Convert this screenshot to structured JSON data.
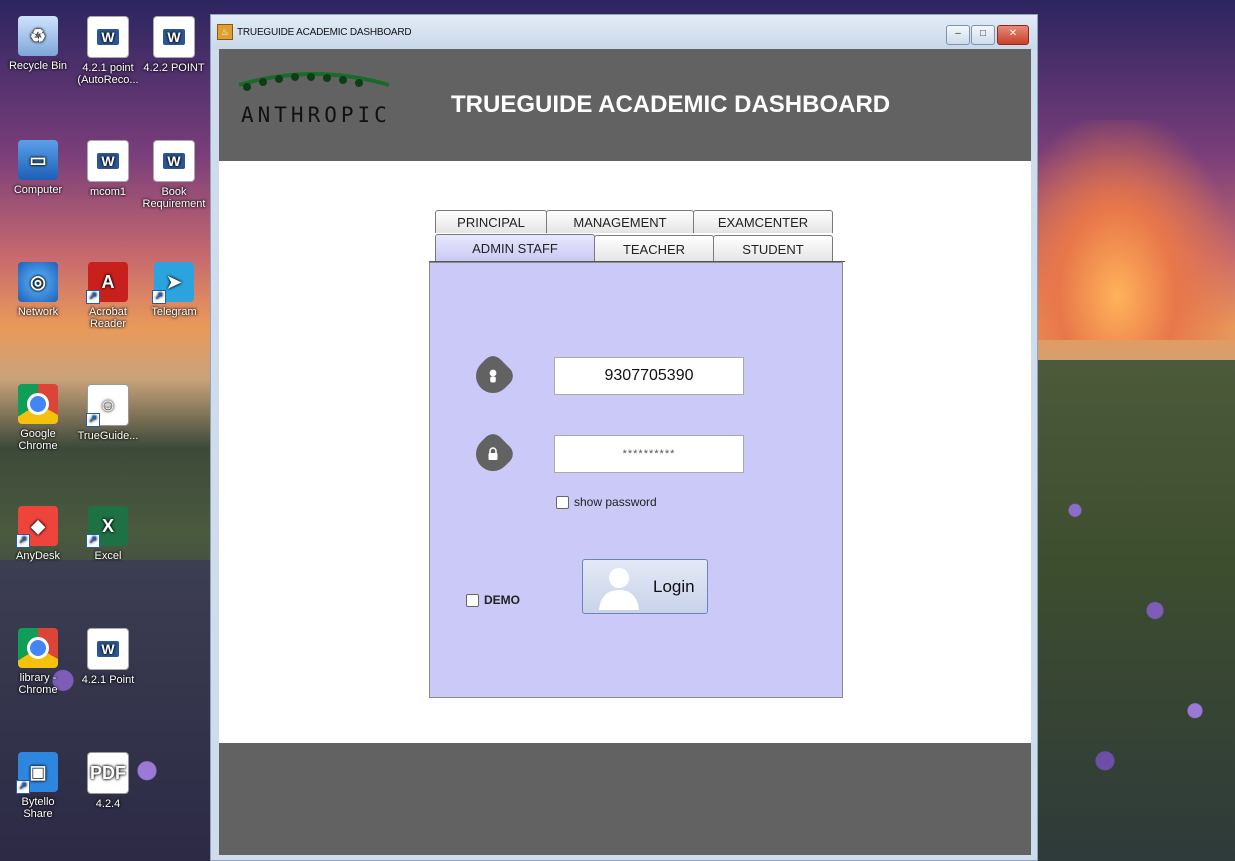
{
  "desktop": {
    "icons": [
      {
        "label": "Recycle Bin"
      },
      {
        "label": "4.2.1 point (AutoReco..."
      },
      {
        "label": "4.2.2 POINT"
      },
      {
        "label": "Computer"
      },
      {
        "label": "mcom1"
      },
      {
        "label": "Book Requirement"
      },
      {
        "label": "Network"
      },
      {
        "label": "Acrobat Reader"
      },
      {
        "label": "Telegram"
      },
      {
        "label": "Google Chrome"
      },
      {
        "label": "TrueGuide..."
      },
      {
        "label": "AnyDesk"
      },
      {
        "label": "Excel"
      },
      {
        "label": "library - Chrome"
      },
      {
        "label": "4.2.1 Point"
      },
      {
        "label": "Bytello Share"
      },
      {
        "label": "4.2.4"
      }
    ]
  },
  "window": {
    "title": "TRUEGUIDE ACADEMIC DASHBOARD",
    "controls": {
      "minimize": "–",
      "maximize": "□",
      "close": "✕"
    }
  },
  "header": {
    "logo_text": "ANTHROPIC",
    "title": "TRUEGUIDE ACADEMIC DASHBOARD"
  },
  "tabs": {
    "row1": [
      "PRINCIPAL",
      "MANAGEMENT",
      "EXAMCENTER"
    ],
    "row2": [
      "ADMIN STAFF",
      "TEACHER",
      "STUDENT"
    ],
    "selected": "ADMIN STAFF"
  },
  "login": {
    "username_value": "9307705390",
    "password_value": "**********",
    "show_password_label": "show password",
    "demo_label": "DEMO",
    "login_button_label": "Login"
  },
  "colors": {
    "header_bg": "#626262",
    "panel_bg": "#cac9f7",
    "logo_green": "#1a6b2a"
  }
}
